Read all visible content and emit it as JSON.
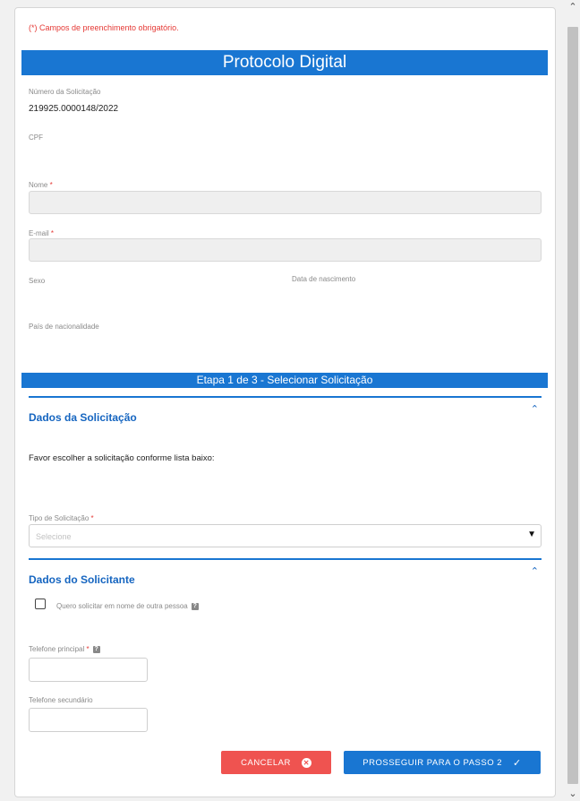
{
  "form": {
    "required_note": "(*) Campos de preenchimento obrigatório.",
    "title": "Protocolo Digital",
    "numero_label": "Número da Solicitação",
    "numero_value": "219925.0000148/2022",
    "cpf_label": "CPF",
    "nome_label": "Nome",
    "email_label": "E-mail",
    "sexo_label": "Sexo",
    "nascimento_label": "Data de nascimento",
    "pais_label": "País de nacionalidade",
    "required_star": "*"
  },
  "step": {
    "title": "Etapa 1 de 3 - Selecionar Solicitação"
  },
  "dados_solicitacao": {
    "title": "Dados da Solicitação",
    "instruction": "Favor escolher a solicitação conforme lista baixo:",
    "tipo_label": "Tipo de Solicitação",
    "tipo_placeholder": "Selecione",
    "tipo_selected": "Selecione"
  },
  "dados_solicitante": {
    "title": "Dados do Solicitante",
    "checkbox_label": "Quero solicitar em nome de outra pessoa",
    "telefone_principal_label": "Telefone principal",
    "telefone_secundario_label": "Telefone secundário"
  },
  "buttons": {
    "cancel": "CANCELAR",
    "next": "PROSSEGUIR PARA O PASSO 2"
  },
  "icons": {
    "chevron": "chevron-up-icon",
    "help": "help-icon",
    "cancel": "close-circle-icon",
    "next": "check-icon"
  },
  "colors": {
    "primary": "#1976d2",
    "danger": "#ef5350",
    "required": "#e53935"
  }
}
